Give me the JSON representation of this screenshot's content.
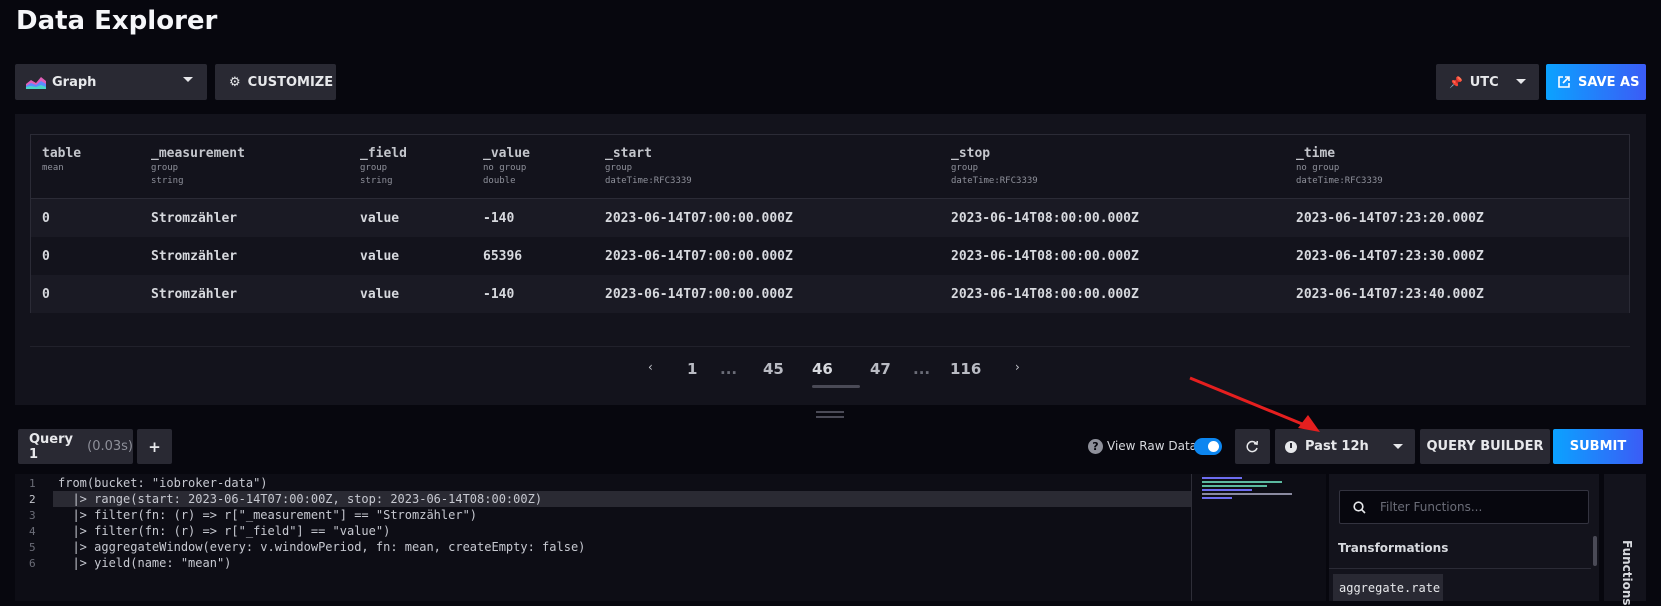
{
  "page_title": "Data Explorer",
  "toolbar": {
    "view_type": "Graph",
    "customize_label": "CUSTOMIZE",
    "timezone": "UTC",
    "save_as_label": "SAVE AS"
  },
  "table": {
    "columns": [
      {
        "name": "table",
        "sub1": "mean",
        "sub2": ""
      },
      {
        "name": "_measurement",
        "sub1": "group",
        "sub2": "string"
      },
      {
        "name": "_field",
        "sub1": "group",
        "sub2": "string"
      },
      {
        "name": "_value",
        "sub1": "no group",
        "sub2": "double"
      },
      {
        "name": "_start",
        "sub1": "group",
        "sub2": "dateTime:RFC3339"
      },
      {
        "name": "_stop",
        "sub1": "group",
        "sub2": "dateTime:RFC3339"
      },
      {
        "name": "_time",
        "sub1": "no group",
        "sub2": "dateTime:RFC3339"
      }
    ],
    "rows": [
      [
        "0",
        "Stromzähler",
        "value",
        "-140",
        "2023-06-14T07:00:00.000Z",
        "2023-06-14T08:00:00.000Z",
        "2023-06-14T07:23:20.000Z"
      ],
      [
        "0",
        "Stromzähler",
        "value",
        "65396",
        "2023-06-14T07:00:00.000Z",
        "2023-06-14T08:00:00.000Z",
        "2023-06-14T07:23:30.000Z"
      ],
      [
        "0",
        "Stromzähler",
        "value",
        "-140",
        "2023-06-14T07:00:00.000Z",
        "2023-06-14T08:00:00.000Z",
        "2023-06-14T07:23:40.000Z"
      ]
    ]
  },
  "pagination": {
    "pages": [
      "1",
      "...",
      "45",
      "46",
      "47",
      "...",
      "116"
    ],
    "current": "46"
  },
  "query": {
    "tab_label": "Query 1",
    "tab_time": "(0.03s)",
    "add_label": "+",
    "view_raw_label": "View Raw Data",
    "time_range": "Past 12h",
    "query_builder_label": "QUERY BUILDER",
    "submit_label": "SUBMIT"
  },
  "editor": {
    "line_numbers": [
      "1",
      "2",
      "3",
      "4",
      "5",
      "6"
    ],
    "lines": [
      "from(bucket: \"iobroker-data\")",
      "  |> range(start: 2023-06-14T07:00:00Z, stop: 2023-06-14T08:00:00Z)",
      "  |> filter(fn: (r) => r[\"_measurement\"] == \"Stromzähler\")",
      "  |> filter(fn: (r) => r[\"_field\"] == \"value\")",
      "  |> aggregateWindow(every: v.windowPeriod, fn: mean, createEmpty: false)",
      "  |> yield(name: \"mean\")"
    ]
  },
  "functions": {
    "search_placeholder": "Filter Functions...",
    "section_title": "Transformations",
    "first_item": "aggregate.rate",
    "sidebar_label": "Functions"
  },
  "colors": {
    "accent_blue": "#0ba2ff",
    "annotation_arrow": "#e51f1f"
  }
}
